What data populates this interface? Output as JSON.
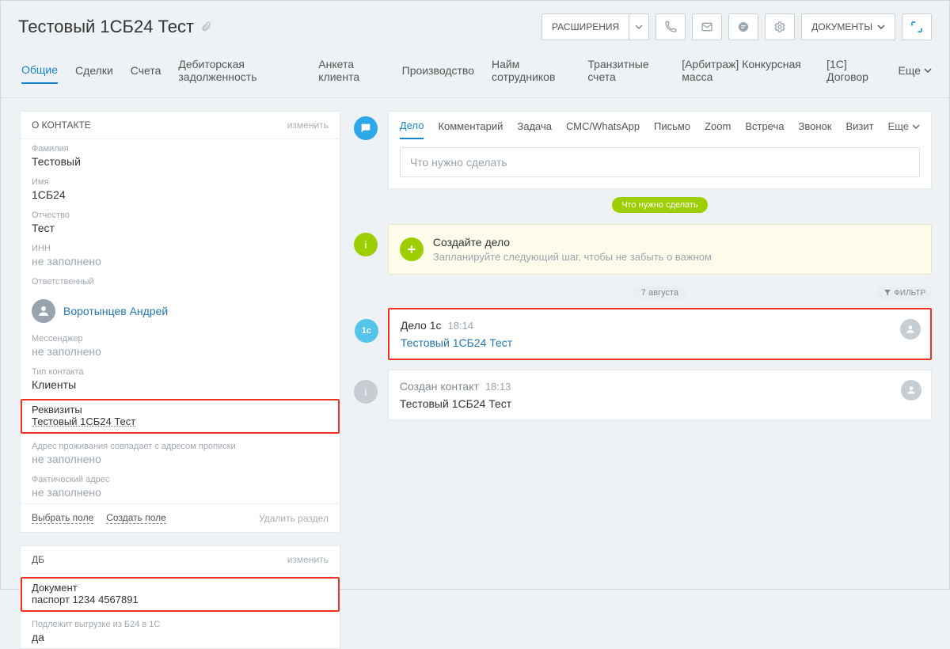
{
  "header": {
    "title": "Тестовый 1СБ24 Тест",
    "ext_label": "РАСШИРЕНИЯ",
    "docs_label": "ДОКУМЕНТЫ"
  },
  "mainTabs": {
    "items": [
      "Общие",
      "Сделки",
      "Счета",
      "Дебиторская задолженность",
      "Анкета клиента",
      "Производство",
      "Найм сотрудников",
      "Транзитные счета",
      "[Арбитраж] Конкурсная масса",
      "[1С] Договор"
    ],
    "more": "Еще"
  },
  "about": {
    "title": "О КОНТАКТЕ",
    "edit": "изменить",
    "lastname_lbl": "Фамилия",
    "lastname_val": "Тестовый",
    "firstname_lbl": "Имя",
    "firstname_val": "1СБ24",
    "patronymic_lbl": "Отчество",
    "patronymic_val": "Тест",
    "inn_lbl": "ИНН",
    "inn_val": "не заполнено",
    "responsible_lbl": "Ответственный",
    "responsible_val": "Воротынцев Андрей",
    "messenger_lbl": "Мессенджер",
    "messenger_val": "не заполнено",
    "contact_type_lbl": "Тип контакта",
    "contact_type_val": "Клиенты",
    "requisites_lbl": "Реквизиты",
    "requisites_val": "Тестовый 1СБ24 Тест",
    "addr_match_lbl": "Адрес проживания совпадает с адресом прописки",
    "addr_match_val": "не заполнено",
    "fact_addr_lbl": "Фактический адрес",
    "fact_addr_val": "не заполнено",
    "select_field": "Выбрать поле",
    "create_field": "Создать поле",
    "delete_section": "Удалить раздел"
  },
  "db": {
    "title": "ДБ",
    "edit": "изменить",
    "doc_lbl": "Документ",
    "doc_val": "паспорт 1234 4567891",
    "upload_lbl": "Подлежит выгрузке из Б24 в 1С",
    "upload_val": "да"
  },
  "activity": {
    "tabs": [
      "Дело",
      "Комментарий",
      "Задача",
      "СМС/WhatsApp",
      "Письмо",
      "Zoom",
      "Встреча",
      "Звонок",
      "Визит"
    ],
    "more": "Еще",
    "input_placeholder": "Что нужно сделать",
    "pill": "Что нужно сделать",
    "create_title": "Создайте дело",
    "create_sub": "Запланируйте следующий шаг, чтобы не забыть о важном",
    "date": "7 августа",
    "filter": "ФИЛЬТР",
    "ev1_title": "Дело 1с",
    "ev1_time": "18:14",
    "ev1_link": "Тестовый 1СБ24 Тест",
    "ev2_title": "Создан контакт",
    "ev2_time": "18:13",
    "ev2_text": "Тестовый 1СБ24 Тест"
  }
}
